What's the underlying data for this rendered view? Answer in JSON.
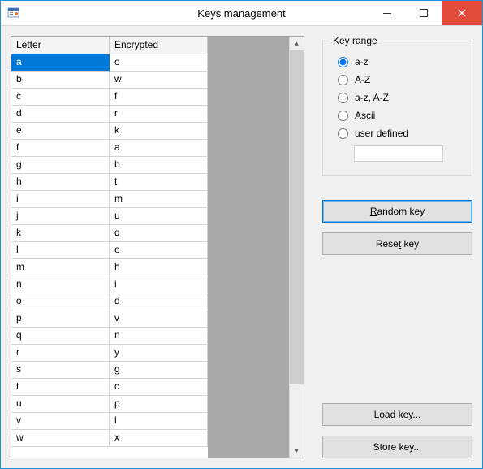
{
  "window": {
    "title": "Keys management"
  },
  "grid": {
    "headers": {
      "letter": "Letter",
      "encrypted": "Encrypted"
    },
    "rows": [
      {
        "letter": "a",
        "encrypted": "o",
        "selected": true
      },
      {
        "letter": "b",
        "encrypted": "w"
      },
      {
        "letter": "c",
        "encrypted": "f"
      },
      {
        "letter": "d",
        "encrypted": "r"
      },
      {
        "letter": "e",
        "encrypted": "k"
      },
      {
        "letter": "f",
        "encrypted": "a"
      },
      {
        "letter": "g",
        "encrypted": "b"
      },
      {
        "letter": "h",
        "encrypted": "t"
      },
      {
        "letter": "i",
        "encrypted": "m"
      },
      {
        "letter": "j",
        "encrypted": "u"
      },
      {
        "letter": "k",
        "encrypted": "q"
      },
      {
        "letter": "l",
        "encrypted": "e"
      },
      {
        "letter": "m",
        "encrypted": "h"
      },
      {
        "letter": "n",
        "encrypted": "i"
      },
      {
        "letter": "o",
        "encrypted": "d"
      },
      {
        "letter": "p",
        "encrypted": "v"
      },
      {
        "letter": "q",
        "encrypted": "n"
      },
      {
        "letter": "r",
        "encrypted": "y"
      },
      {
        "letter": "s",
        "encrypted": "g"
      },
      {
        "letter": "t",
        "encrypted": "c"
      },
      {
        "letter": "u",
        "encrypted": "p"
      },
      {
        "letter": "v",
        "encrypted": "l"
      },
      {
        "letter": "w",
        "encrypted": "x"
      }
    ]
  },
  "key_range": {
    "legend": "Key range",
    "options": [
      {
        "id": "az",
        "label": "a-z",
        "checked": true
      },
      {
        "id": "AZ",
        "label": "A-Z",
        "checked": false
      },
      {
        "id": "azAZ",
        "label": "a-z, A-Z",
        "checked": false
      },
      {
        "id": "ascii",
        "label": "Ascii",
        "checked": false
      },
      {
        "id": "user",
        "label": "user defined",
        "checked": false
      }
    ],
    "user_defined_value": ""
  },
  "buttons": {
    "random_prefix": "R",
    "random_rest": "andom key",
    "reset_prefix": "Rese",
    "reset_u": "t",
    "reset_rest": " key",
    "load": "Load key...",
    "store": "Store key..."
  }
}
